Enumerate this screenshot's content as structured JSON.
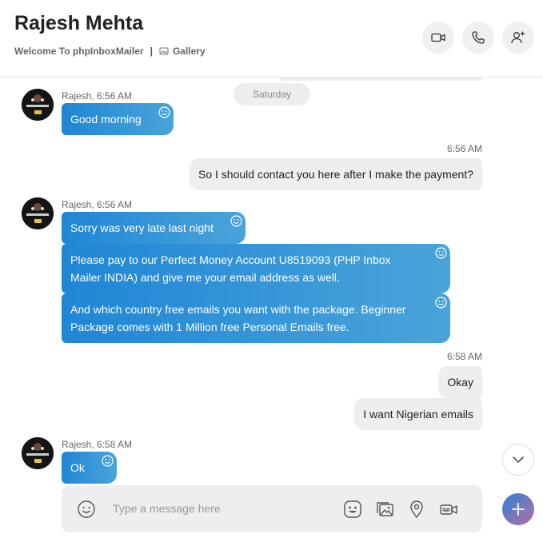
{
  "header": {
    "contact_name": "Rajesh Mehta",
    "subtitle": "Welcome To phpInboxMailer",
    "separator": "|",
    "gallery_label": "Gallery",
    "buttons": [
      "video-call",
      "audio-call",
      "add-people"
    ]
  },
  "chat": {
    "date_divider": "Saturday",
    "messages": [
      {
        "direction": "in",
        "sender": "Rajesh, 6:56 AM",
        "text": "Good morning"
      },
      {
        "direction": "out",
        "time": "6:56 AM",
        "text": "So I should contact you here after I make the payment?"
      },
      {
        "direction": "in",
        "sender": "Rajesh, 6:56 AM",
        "text": "Sorry was very late last night"
      },
      {
        "direction": "in",
        "text": "Please pay to our Perfect Money Account U8519093 (PHP Inbox Mailer INDIA) and give me your email address as well."
      },
      {
        "direction": "in",
        "text": "And which country free emails you want with the package.  Beginner Package comes with 1 Million free Personal Emails free."
      },
      {
        "direction": "out",
        "time": "6:58 AM",
        "text": "Okay"
      },
      {
        "direction": "out",
        "text": "I want Nigerian emails"
      },
      {
        "direction": "in",
        "sender": "Rajesh, 6:58 AM",
        "text": "Ok"
      }
    ]
  },
  "composer": {
    "placeholder": "Type a message here",
    "icons": [
      "emoji-icon",
      "sticker-icon",
      "media-icon",
      "location-icon",
      "video-message-icon"
    ]
  },
  "colors": {
    "incoming_start": "#1f86d6",
    "incoming_end": "#4aa4d9",
    "outgoing": "#eeeef0"
  }
}
